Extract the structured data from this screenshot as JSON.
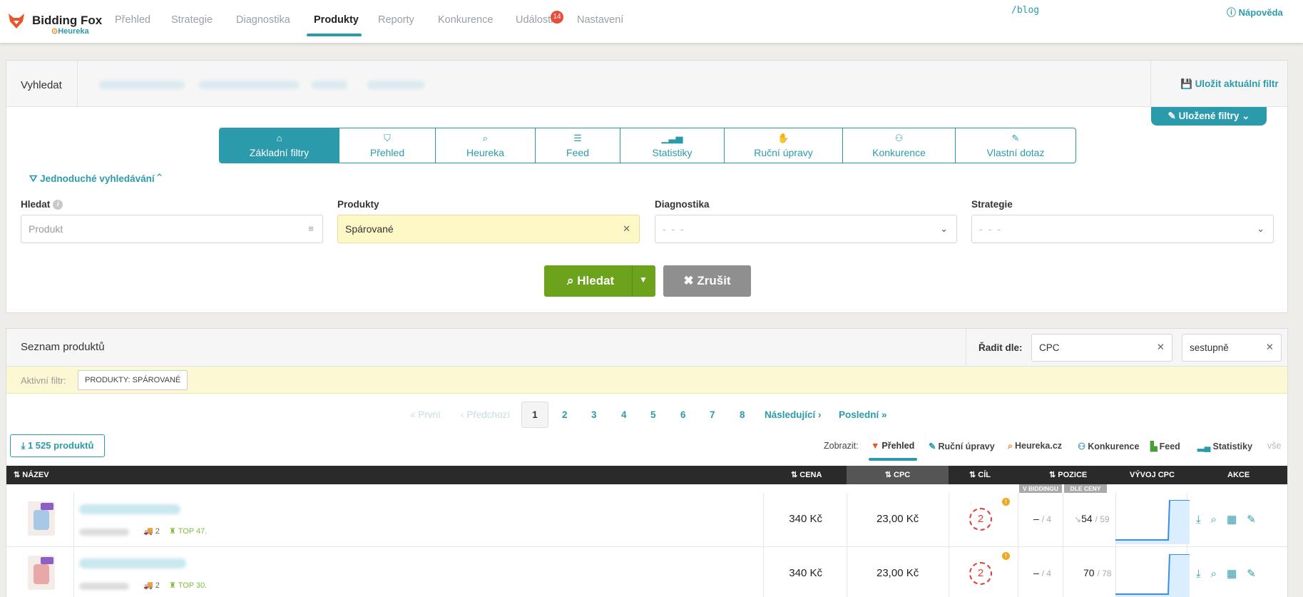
{
  "nav": {
    "brand": "Bidding Fox",
    "brand_sub": "Heureka",
    "items": [
      {
        "label": "Přehled"
      },
      {
        "label": "Strategie"
      },
      {
        "label": "Diagnostika"
      },
      {
        "label": "Produkty"
      },
      {
        "label": "Reporty"
      },
      {
        "label": "Konkurence"
      },
      {
        "label": "Události"
      },
      {
        "label": "Nastavení"
      }
    ],
    "active": "Produkty",
    "events_badge": "14",
    "blog": "/blog",
    "help": "Nápověda"
  },
  "search": {
    "title": "Vyhledat",
    "save_filter": "Uložit aktuální filtr",
    "saved_filters": "Uložené filtry",
    "tabs": [
      {
        "label": "Základní filtry",
        "icon": "home-icon"
      },
      {
        "label": "Přehled",
        "icon": "fox-icon"
      },
      {
        "label": "Heureka",
        "icon": "heureka-search-icon"
      },
      {
        "label": "Feed",
        "icon": "feed-icon"
      },
      {
        "label": "Statistiky",
        "icon": "stats-icon"
      },
      {
        "label": "Ruční úpravy",
        "icon": "hand-icon"
      },
      {
        "label": "Konkurence",
        "icon": "competition-icon"
      },
      {
        "label": "Vlastní dotaz",
        "icon": "pencil-icon"
      }
    ],
    "simple_search": "Jednoduché vyhledávání",
    "fields": {
      "hledat_label": "Hledat",
      "hledat_placeholder": "Produkt",
      "produkty_label": "Produkty",
      "produkty_value": "Spárované",
      "diagnostika_label": "Diagnostika",
      "diagnostika_value": "- - -",
      "strategie_label": "Strategie",
      "strategie_value": "- - -"
    },
    "search_button": "Hledat",
    "cancel_button": "Zrušit"
  },
  "products": {
    "title": "Seznam produktů",
    "sort_label": "Řadit dle:",
    "sort_by": "CPC",
    "sort_order": "sestupně",
    "active_filter_label": "Aktivní filtr:",
    "active_filter_chip": "PRODUKTY: SPÁROVANÉ",
    "pagination": {
      "first": "« První",
      "prev": "‹ Předchozí",
      "current": "1",
      "pages": [
        "2",
        "3",
        "4",
        "5",
        "6",
        "7",
        "8"
      ],
      "next": "Následující ›",
      "last": "Poslední »"
    },
    "count_button": "1 525 produktů",
    "show_label": "Zobrazit:",
    "views": [
      "Přehled",
      "Ruční úpravy",
      "Heureka.cz",
      "Konkurence",
      "Feed",
      "Statistiky",
      "vše"
    ],
    "columns": {
      "name": "NÁZEV",
      "price": "CENA",
      "cpc": "CPC",
      "goal": "CÍL",
      "position": "POZICE",
      "pos_bidding": "V BIDDINGU",
      "pos_price": "DLE CENY",
      "cpc_trend": "VÝVOJ CPC",
      "actions": "AKCE"
    },
    "rows": [
      {
        "delivery": "2",
        "top": "TOP 47.",
        "price": "340 Kč",
        "cpc": "23,00 Kč",
        "goal": "2",
        "bidding": "–",
        "bidding_of": "/ 4",
        "by_price": "54",
        "by_price_of": "/ 59",
        "trend_arrow": "↘"
      },
      {
        "delivery": "2",
        "top": "TOP 30.",
        "price": "340 Kč",
        "cpc": "23,00 Kč",
        "goal": "2",
        "bidding": "–",
        "bidding_of": "/ 4",
        "by_price": "70",
        "by_price_of": "/ 78",
        "trend_arrow": ""
      }
    ]
  },
  "colors": {
    "accent": "#2b9bab",
    "search_green": "#6da21c",
    "cancel_gray": "#8f8f8f",
    "badge_red": "#e74c3c",
    "filter_yellow": "#fcf8d3"
  }
}
